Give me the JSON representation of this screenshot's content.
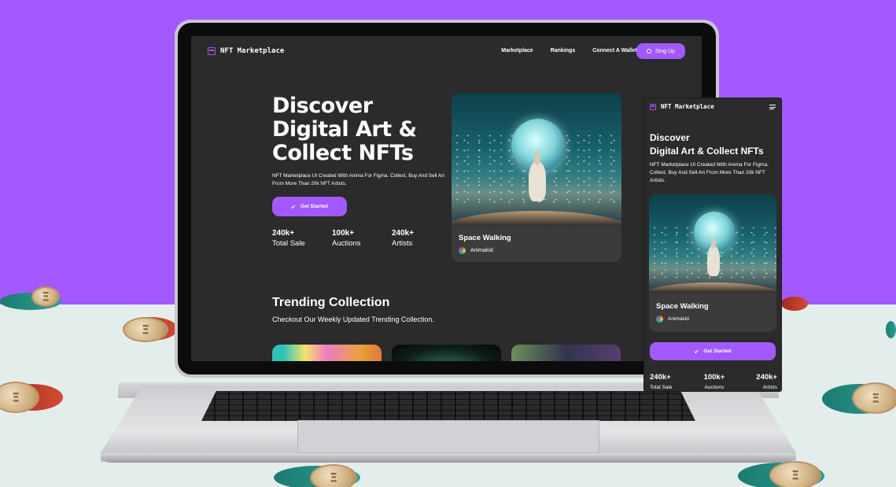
{
  "colors": {
    "accent": "#a259ff",
    "background": "#2b2b2b",
    "card": "#3b3b3b",
    "text": "#ffffff"
  },
  "desktop": {
    "nav": {
      "logo_text": "NFT Marketplace",
      "logo_icon": "storefront-icon",
      "links": [
        "Marketplace",
        "Rankings",
        "Connect A Wallet"
      ],
      "signup_label": "Sing Up",
      "signup_icon": "user-icon"
    },
    "hero": {
      "title_lines": [
        "Discover",
        "Digital Art &",
        "Collect NFTs"
      ],
      "subtitle": "NFT Marketplace UI Created With Anima For Figma. Collect, Buy And Sell Art From More Than 20k NFT Artists.",
      "cta_label": "Get Started",
      "cta_icon": "rocket-icon",
      "stats": [
        {
          "value": "240k+",
          "label": "Total Sale"
        },
        {
          "value": "100k+",
          "label": "Auctions"
        },
        {
          "value": "240k+",
          "label": "Artists"
        }
      ]
    },
    "featured": {
      "title": "Space Walking",
      "artist": "Animakid"
    },
    "trending": {
      "title": "Trending Collection",
      "subtitle": "Checkout Our Weekly Updated Trending Collection."
    }
  },
  "mobile": {
    "logo_text": "NFT Marketplace",
    "menu_icon": "hamburger-icon",
    "title_lines": [
      "Discover",
      "Digital Art & Collect NFTs"
    ],
    "subtitle": "NFT Marketplace UI Created With Anima For Figma. Collect, Buy And Sell Art From More Than 20k NFT Artists.",
    "featured": {
      "title": "Space Walking",
      "artist": "Animakid"
    },
    "cta_label": "Get Started",
    "stats": [
      {
        "value": "240k+",
        "label": "Total Sale"
      },
      {
        "value": "100k+",
        "label": "Auctions"
      },
      {
        "value": "240k+",
        "label": "Artists"
      }
    ]
  }
}
